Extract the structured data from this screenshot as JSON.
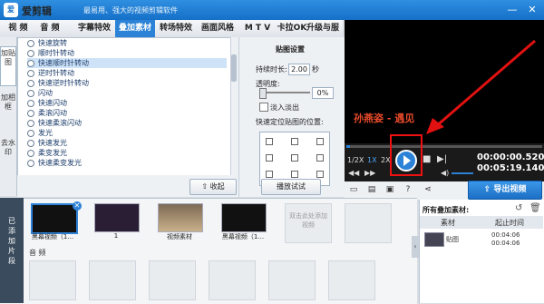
{
  "app": {
    "name": "爱剪辑",
    "slogan": "最易用、强大的视频剪辑软件",
    "logo_text": "爱",
    "controls": [
      "minimize-icon",
      "close-icon"
    ]
  },
  "tabs": [
    {
      "label": "视 频"
    },
    {
      "label": "音 频"
    },
    {
      "label": "字幕特效"
    },
    {
      "label": "叠加素材"
    },
    {
      "label": "转场特效"
    },
    {
      "label": "画面风格"
    },
    {
      "label": "M T V"
    },
    {
      "label": "卡拉OK"
    },
    {
      "label": "升级与服务"
    }
  ],
  "side_nav": [
    {
      "label": "加贴图"
    },
    {
      "label": "加相框"
    },
    {
      "label": "去水印"
    }
  ],
  "effects": [
    {
      "label": "快速旋转"
    },
    {
      "label": "顺时针转动"
    },
    {
      "label": "快速顺时针转动"
    },
    {
      "label": "逆时针转动"
    },
    {
      "label": "快速逆时针转动"
    },
    {
      "label": "闪动"
    },
    {
      "label": "快速闪动"
    },
    {
      "label": "柔滚闪动"
    },
    {
      "label": "快速柔滚闪动"
    },
    {
      "label": "发光"
    },
    {
      "label": "快速发光"
    },
    {
      "label": "柔变发光"
    },
    {
      "label": "快速柔变发光"
    }
  ],
  "selected_effect": "快速顺时针转动",
  "list_buttons": {
    "collapse": "收起"
  },
  "settings": {
    "title": "贴图设置",
    "duration_label": "持续时长:",
    "duration_value": "2.00",
    "duration_unit": "秒",
    "opacity_label": "透明度:",
    "opacity_value": "0%",
    "fade_label": "淡入淡出",
    "position_label": "快速定位贴图的位置:",
    "preview_button": "播放试试"
  },
  "preview": {
    "overlay_text": "孙燕姿 - 遇见",
    "speeds": [
      "1/2X",
      "1X",
      "2X"
    ],
    "current_time": "00:00:00.520",
    "total_time": "00:05:19.140",
    "progress": 0.02
  },
  "toolbar": {
    "export_label": "导出视频"
  },
  "timeline": {
    "side_label": "已添加片段",
    "clips": [
      {
        "name": "黑幕视频（1..."
      },
      {
        "name": "1"
      },
      {
        "name": "视频素材"
      },
      {
        "name": "黑幕视频（1..."
      }
    ],
    "add_hint": "双击此处添加视频",
    "audio_label": "音 频"
  },
  "materials": {
    "title": "所有叠加素材:",
    "col_material": "素材",
    "col_time": "起止时间",
    "items": [
      {
        "name": "贴图",
        "start": "00:04:06",
        "end": "00:04:06"
      }
    ]
  },
  "colors": {
    "accent": "#2c82d6",
    "annotation": "#e11111",
    "title_bar": "#1570c8"
  }
}
